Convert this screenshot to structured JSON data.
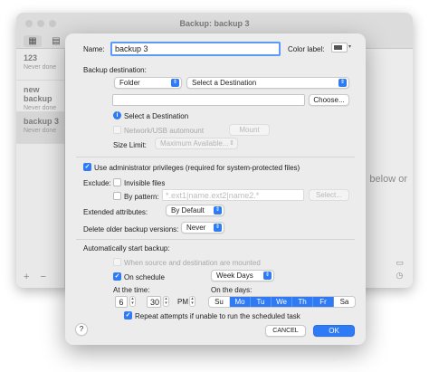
{
  "background_window": {
    "title": "Backup: backup 3",
    "tasks": [
      {
        "name": "123",
        "status": "Never done"
      },
      {
        "name": "new backup",
        "status": "Never done"
      },
      {
        "name": "backup 3",
        "status": "Never done"
      }
    ],
    "hint_text": "below or",
    "add_label": "+",
    "remove_label": "−"
  },
  "sheet": {
    "name_label": "Name:",
    "name_value": "backup 3",
    "color_label": "Color label:",
    "destination_label": "Backup destination:",
    "destination_type": "Folder",
    "destination_select": "Select a Destination",
    "choose_button": "Choose...",
    "info_text": "Select a Destination",
    "network_automount": "Network/USB automount",
    "mount_button": "Mount",
    "size_limit_label": "Size Limit:",
    "size_limit_value": "Maximum Available...",
    "admin_privileges": "Use administrator privileges (required for system-protected files)",
    "exclude_label": "Exclude:",
    "invisible_files": "Invisible files",
    "by_pattern": "By pattern:",
    "pattern_placeholder": "*.ext1|name.ext2|name2.*",
    "select_button": "Select...",
    "extended_attributes_label": "Extended attributes:",
    "extended_attributes_value": "By Default",
    "delete_older_label": "Delete older backup versions:",
    "delete_older_value": "Never",
    "auto_backup_label": "Automatically start backup:",
    "when_mounted": "When source and destination are mounted",
    "on_schedule": "On schedule",
    "schedule_value": "Week Days",
    "at_time_label": "At the time:",
    "hour": "6",
    "minute": "30",
    "ampm": "PM",
    "on_days_label": "On the days:",
    "days": [
      {
        "label": "Su",
        "on": false
      },
      {
        "label": "Mo",
        "on": true
      },
      {
        "label": "Tu",
        "on": true
      },
      {
        "label": "We",
        "on": true
      },
      {
        "label": "Th",
        "on": true
      },
      {
        "label": "Fr",
        "on": true
      },
      {
        "label": "Sa",
        "on": false
      }
    ],
    "repeat_attempts": "Repeat attempts if unable to run the scheduled task",
    "help_label": "?",
    "cancel_button": "CANCEL",
    "ok_button": "OK"
  },
  "colors": {
    "accent": "#2f7bf6",
    "sheet_bg": "#ececec"
  }
}
